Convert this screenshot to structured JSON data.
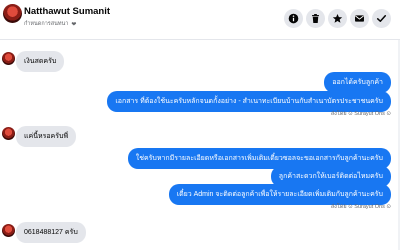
{
  "header": {
    "name": "Natthawut Sumanit",
    "subtitle": "กำหนดการสนทนา",
    "heart": "❤"
  },
  "colors": {
    "accent": "#1877f2",
    "incoming_bubble": "#e4e6eb",
    "header_button": "#e4e6eb"
  },
  "header_buttons": [
    {
      "name": "info-icon"
    },
    {
      "name": "trash-icon"
    },
    {
      "name": "star-icon"
    },
    {
      "name": "mail-icon"
    },
    {
      "name": "check-icon"
    }
  ],
  "messages": {
    "in1": "เงินสดครับ",
    "out1": "ออกได้ครับลูกค้า",
    "out2": "เอกสาร ที่ต้องใช้นะครับหลักจนดกั้งอย่าง - สำเนาทะเบียนบ้านกับสำเนาบัตรประชาชนครับ",
    "sent1": "ส่งโดย ⊙ Surayut Ons ⊙",
    "in2": "แค่นี้หรอครับพี่",
    "out3": "ใช่ครับหากมีรายละเอียดหรือเอกสารเพิ่มเติมเดี๋ยวซอลจะขอเอกสารกับลูกค้านะครับ",
    "out4": "ลูกค้าสะดวกให้เบอร์ติดต่อไหมครับ",
    "out5": "เดี๋ยว Admin จะติดต่อลูกค้าเพื่อให้รายละเอียดเพิ่มเติมกับลูกค้านะครับ",
    "sent2": "ส่งโดย ⊙ Surayut Ons ⊙",
    "in3": "0618488127 ครับ"
  }
}
